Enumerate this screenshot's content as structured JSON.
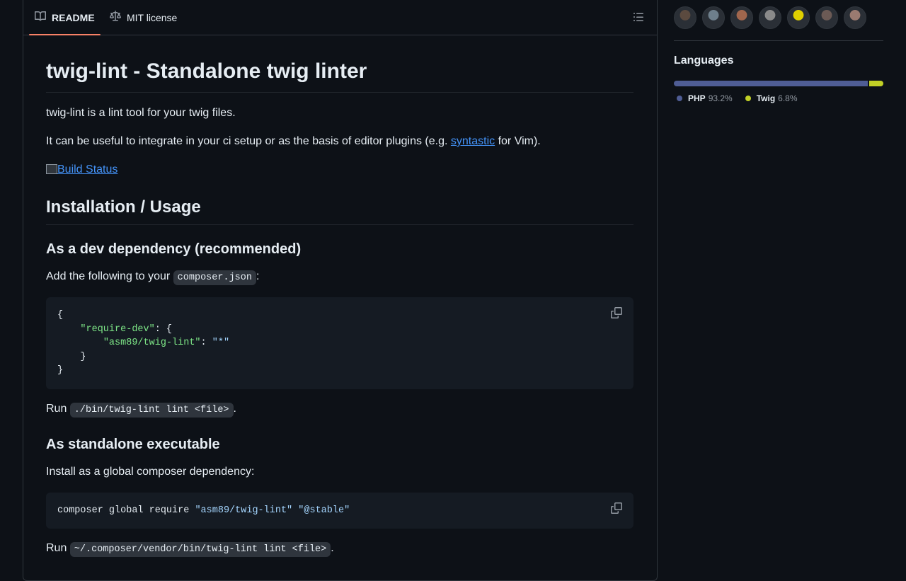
{
  "tabs": {
    "readme": "README",
    "license": "MIT license"
  },
  "readme": {
    "title": "twig-lint - Standalone twig linter",
    "intro": "twig-lint is a lint tool for your twig files.",
    "usage_pre": "It can be useful to integrate in your ci setup or as the basis of editor plugins (e.g. ",
    "usage_link": "syntastic",
    "usage_post": " for Vim).",
    "badge_alt": "Build Status",
    "h2_install": "Installation / Usage",
    "h3_dev": "As a dev dependency (recommended)",
    "add_pre": "Add the following to your ",
    "add_code": "composer.json",
    "add_post": ":",
    "code1": {
      "open": "{",
      "key1": "\"require-dev\"",
      "sep1": ": {",
      "key2": "\"asm89/twig-lint\"",
      "sep2": ": ",
      "val2": "\"*\"",
      "close_inner": "}",
      "close": "}"
    },
    "run1_pre": "Run ",
    "run1_code": "./bin/twig-lint lint <file>",
    "run1_post": ".",
    "h3_standalone": "As standalone executable",
    "install_global": "Install as a global composer dependency:",
    "code2": {
      "cmd": "composer global require ",
      "arg1": "\"asm89/twig-lint\"",
      "arg2": "\"@stable\""
    },
    "run2_pre": "Run ",
    "run2_code": "~/.composer/vendor/bin/twig-lint lint <file>",
    "run2_post": "."
  },
  "sidebar": {
    "languages_title": "Languages",
    "languages": [
      {
        "name": "PHP",
        "percent": "93.2%",
        "value": 93.2,
        "color": "#4F5D95"
      },
      {
        "name": "Twig",
        "percent": "6.8%",
        "value": 6.8,
        "color": "#c1d026"
      }
    ],
    "avatar_colors": [
      "#5b4a3f",
      "#6e7f8c",
      "#a0664d",
      "#8a8a8a",
      "#e0d000",
      "#6b5a55",
      "#9a7a70"
    ]
  },
  "icons": {
    "readme": "book-icon",
    "license": "scale-icon",
    "toc": "list-icon",
    "copy": "copy-icon"
  }
}
